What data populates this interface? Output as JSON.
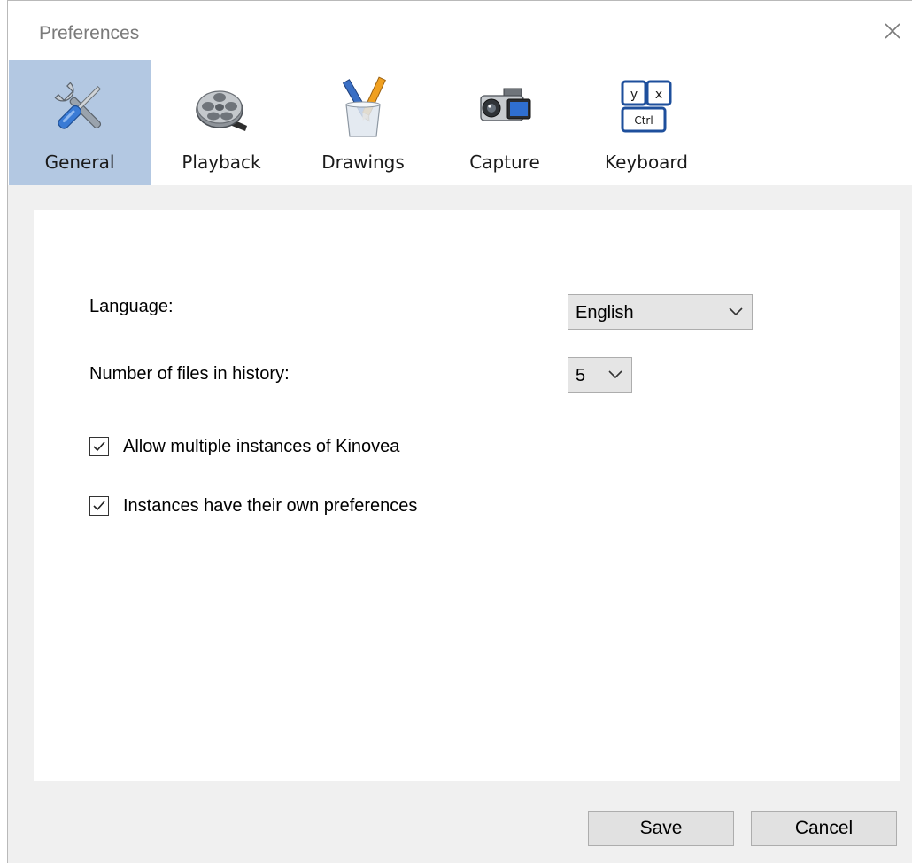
{
  "window": {
    "title": "Preferences"
  },
  "tabs": [
    {
      "label": "General",
      "icon": "tools-icon",
      "selected": true
    },
    {
      "label": "Playback",
      "icon": "film-reel-icon",
      "selected": false
    },
    {
      "label": "Drawings",
      "icon": "pencil-cup-icon",
      "selected": false
    },
    {
      "label": "Capture",
      "icon": "camera-icon",
      "selected": false
    },
    {
      "label": "Keyboard",
      "icon": "keyboard-keys-icon",
      "selected": false
    }
  ],
  "keyboard_icon_keys": {
    "y": "y",
    "x": "x",
    "ctrl": "Ctrl"
  },
  "general": {
    "language_label": "Language:",
    "language_value": "English",
    "history_label": "Number of files in history:",
    "history_value": "5",
    "allow_multiple_label": "Allow multiple instances of Kinovea",
    "allow_multiple_checked": true,
    "own_prefs_label": "Instances have their own preferences",
    "own_prefs_checked": true
  },
  "buttons": {
    "save": "Save",
    "cancel": "Cancel"
  },
  "colors": {
    "selected_tab": "#b3c8e2",
    "panel": "#ffffff",
    "window_bg": "#f0f0f0"
  }
}
